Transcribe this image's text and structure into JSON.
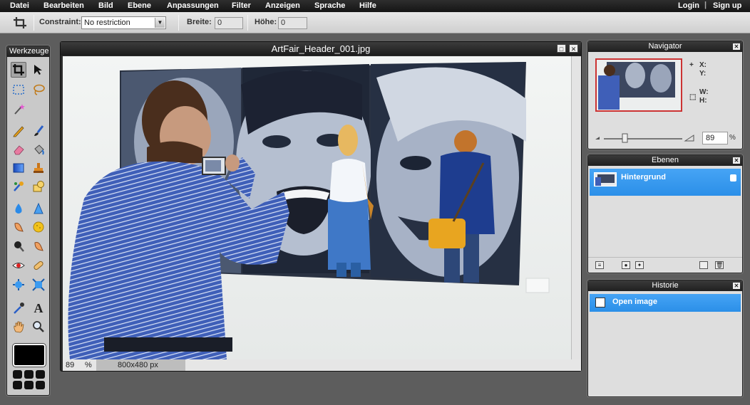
{
  "menu": {
    "items": [
      "Datei",
      "Bearbeiten",
      "Bild",
      "Ebene",
      "Anpassungen",
      "Filter",
      "Anzeigen",
      "Sprache",
      "Hilfe"
    ],
    "login": "Login",
    "separator": "|",
    "signup": "Sign up"
  },
  "options": {
    "constraint_label": "Constraint:",
    "constraint_value": "No restriction",
    "width_label": "Breite:",
    "width_value": "0",
    "height_label": "Höhe:",
    "height_value": "0"
  },
  "tools": {
    "title": "Werkzeuge",
    "icons": [
      "crop-icon",
      "move-icon",
      "marquee-icon",
      "lasso-icon",
      "magic-wand-icon",
      "pencil-icon",
      "brush-icon",
      "eraser-icon",
      "paint-bucket-icon",
      "gradient-icon",
      "stamp-icon",
      "color-replace-icon",
      "shape-icon",
      "drop-icon",
      "sharpen-icon",
      "smudge-icon",
      "sponge-icon",
      "burn-icon",
      "dodge-icon",
      "red-eye-icon",
      "spot-heal-icon",
      "bloat-icon",
      "pinch-icon",
      "color-picker-icon",
      "type-icon",
      "hand-icon",
      "zoom-icon"
    ],
    "foreground_color": "#000000"
  },
  "document": {
    "title": "ArtFair_Header_001.jpg",
    "zoom": "89",
    "zoom_unit": "%",
    "dimensions": "800x480 px"
  },
  "navigator": {
    "title": "Navigator",
    "x_label": "X:",
    "y_label": "Y:",
    "w_label": "W:",
    "h_label": "H:",
    "zoom": "89",
    "zoom_unit": "%"
  },
  "layers": {
    "title": "Ebenen",
    "items": [
      {
        "name": "Hintergrund",
        "locked": true
      }
    ]
  },
  "history": {
    "title": "Historie",
    "items": [
      "Open image"
    ]
  },
  "colors": {
    "selection": "#2b8fe8",
    "menubar": "#1b1b1b",
    "workspace": "#5d5d5d"
  }
}
